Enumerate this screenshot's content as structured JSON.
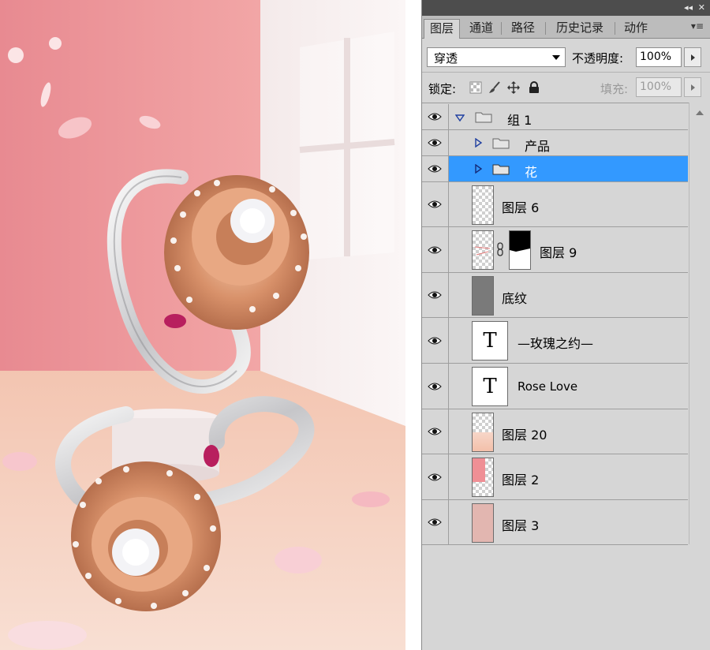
{
  "panel": {
    "tabs": [
      {
        "label": "图层",
        "active": true
      },
      {
        "label": "通道",
        "active": false
      },
      {
        "label": "路径",
        "active": false
      },
      {
        "label": "历史记录",
        "active": false
      },
      {
        "label": "动作",
        "active": false
      }
    ],
    "topbar": {
      "collapse": "◂◂",
      "close": "✕"
    },
    "menu": "▾≡",
    "blend_mode": "穿透",
    "opacity_label": "不透明度:",
    "opacity_value": "100%",
    "lock_label": "锁定:",
    "fill_label": "填充:",
    "fill_value": "100%"
  },
  "layers": [
    {
      "name": "组 1",
      "type": "group",
      "expanded": true,
      "visible": true,
      "selected": false
    },
    {
      "name": "产品",
      "type": "group",
      "expanded": false,
      "visible": true,
      "selected": false
    },
    {
      "name": "花",
      "type": "group",
      "expanded": false,
      "visible": true,
      "selected": true
    },
    {
      "name": "图层 6",
      "type": "pixel",
      "visible": true,
      "selected": false
    },
    {
      "name": "图层 9",
      "type": "pixel-mask",
      "visible": true,
      "selected": false
    },
    {
      "name": "底纹",
      "type": "pixel",
      "visible": true,
      "selected": false
    },
    {
      "name": "—玫瑰之约—",
      "type": "text",
      "visible": true,
      "selected": false
    },
    {
      "name": "Rose Love",
      "type": "text",
      "visible": true,
      "selected": false
    },
    {
      "name": "图层 20",
      "type": "pixel",
      "visible": true,
      "selected": false
    },
    {
      "name": "图层 2",
      "type": "pixel",
      "visible": true,
      "selected": false
    },
    {
      "name": "图层 3",
      "type": "pixel",
      "visible": true,
      "selected": false
    }
  ],
  "text_thumb_glyph": "T",
  "colors": {
    "selected": "#3399ff",
    "panel_bg": "#d6d6d6",
    "wall_pink": "#ef9a9e",
    "floor_peach": "#f6d2c3",
    "rose_gold": "#d8916a"
  },
  "icons": [
    "eye-icon",
    "folder-icon",
    "lock-transparent-icon",
    "brush-icon",
    "move-icon",
    "lock-all-icon",
    "chain-link-icon"
  ]
}
